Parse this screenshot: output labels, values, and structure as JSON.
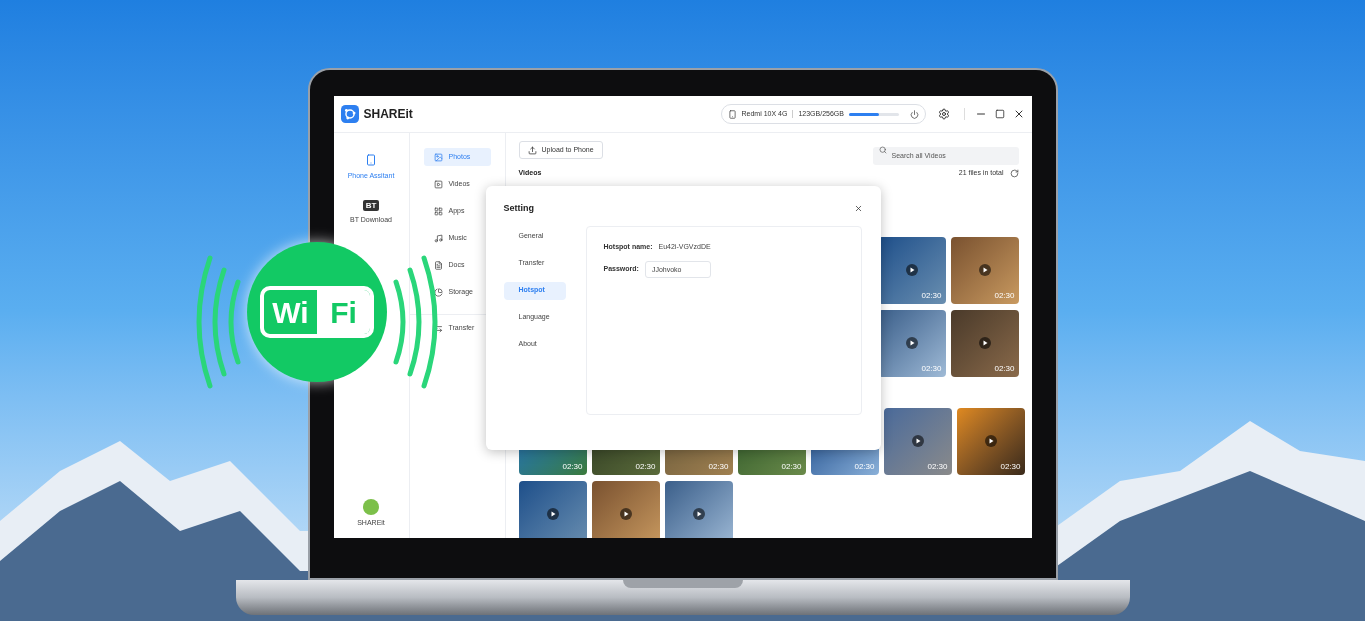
{
  "app": {
    "title": "SHAREit"
  },
  "device": {
    "name": "Redmi 10X 4G",
    "storage": "123GB/256GB",
    "level": 0.6
  },
  "main_nav": [
    {
      "label": "Phone Assitant",
      "selected": true,
      "kind": "phone"
    },
    {
      "label": "BT Download",
      "selected": false,
      "kind": "bt",
      "icon_text": "BT"
    }
  ],
  "profile": {
    "label": "SHAREit"
  },
  "categories": [
    {
      "label": "Photos",
      "selected": true,
      "kind": "photo"
    },
    {
      "label": "Videos",
      "selected": false,
      "kind": "video"
    },
    {
      "label": "Apps",
      "selected": false,
      "kind": "apps"
    },
    {
      "label": "Music",
      "selected": false,
      "kind": "music"
    },
    {
      "label": "Docs",
      "selected": false,
      "kind": "docs"
    },
    {
      "label": "Storage",
      "selected": false,
      "kind": "storage"
    },
    {
      "label": "Transfer",
      "selected": false,
      "kind": "transfer"
    }
  ],
  "toolbar": {
    "upload_button": "Upload to Phone",
    "search": {
      "placeholder": "Search all Videos"
    }
  },
  "section": {
    "title": "Videos",
    "count": "21 files in total"
  },
  "video_groups": [
    {
      "rows": [
        {
          "videos": [
            {
              "duration": "02:30"
            },
            {
              "duration": "02:30"
            }
          ]
        },
        {
          "videos": [
            {
              "duration": "02:30"
            },
            {
              "duration": "02:30"
            }
          ]
        }
      ]
    },
    {
      "rows": [
        {
          "videos": [
            {
              "duration": "02:30"
            },
            {
              "duration": "02:30"
            },
            {
              "duration": "02:30"
            },
            {
              "duration": "02:30"
            },
            {
              "duration": "02:30"
            },
            {
              "duration": "02:30"
            },
            {
              "duration": "02:30"
            }
          ]
        },
        {
          "videos": [
            {
              "kind": "video"
            },
            {
              "kind": "video"
            },
            {
              "kind": "video"
            }
          ]
        }
      ]
    }
  ],
  "dialog": {
    "title": "Setting",
    "tabs": [
      {
        "label": "General",
        "selected": false
      },
      {
        "label": "Transfer",
        "selected": false
      },
      {
        "label": "Hotspot",
        "selected": true
      },
      {
        "label": "Language",
        "selected": false
      },
      {
        "label": "About",
        "selected": false
      }
    ],
    "hotspot_name_label": "Hotspot name:",
    "hotspot_name": "Eu42i-VGVzdDE",
    "password_label": "Password:",
    "password": "JJohvoko"
  },
  "badge": {
    "left": "Wi",
    "right": "Fi"
  }
}
